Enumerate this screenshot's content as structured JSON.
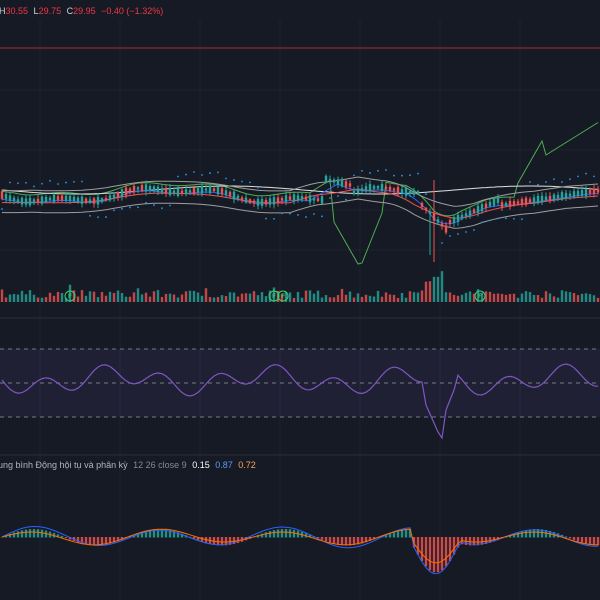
{
  "colors": {
    "background": "#161a25",
    "grid": "#1f2330",
    "up": "#26a69a",
    "down": "#ef5350",
    "red_line": "#b22833",
    "rsi_line": "#7e57c2",
    "macd_line": "#2962ff",
    "signal_line": "#ff6d00",
    "ichimoku_green": "#4caf50",
    "ichimoku_white": "#e0e0e0",
    "psar_blue": "#2196f3",
    "event_marker": "#3bd16f"
  },
  "legend": {
    "h_label": "H",
    "h_value": "30.55",
    "l_label": "L",
    "l_value": "29.75",
    "c_label": "C",
    "c_value": "29.95",
    "change": "−0.40 (−1.32%)"
  },
  "markers": {
    "event_label": "F"
  },
  "macd_legend": {
    "title": "ung bình Động hội tụ và phân kỳ",
    "params": "12 26 close 9",
    "histogram_value": "0.15",
    "macd_value": "0.87",
    "signal_value": "0.72"
  },
  "chart_data": {
    "type": "candlestick",
    "panes": [
      "price",
      "volume",
      "rsi",
      "macd"
    ],
    "last_bar": {
      "high": 30.55,
      "low": 29.75,
      "close": 29.95,
      "change": -0.4,
      "change_percent": -1.32
    },
    "event_markers": [
      "F",
      "F",
      "F",
      "F"
    ],
    "rsi_levels": [
      70,
      50,
      30
    ],
    "macd": {
      "fast": 12,
      "slow": 26,
      "source": "close",
      "signal": 9,
      "histogram": 0.15,
      "macd": 0.87,
      "signal_value": 0.72
    },
    "grid": true
  }
}
